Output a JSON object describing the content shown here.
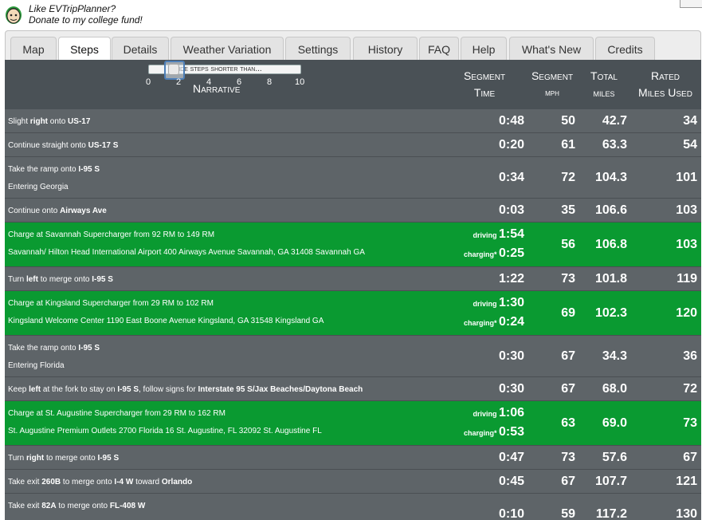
{
  "promo": {
    "line1": "Like EVTripPlanner?",
    "line2": "Donate to my college fund!"
  },
  "tabs": [
    {
      "label": "Map"
    },
    {
      "label": "Steps"
    },
    {
      "label": "Details"
    },
    {
      "label": "Weather Variation"
    },
    {
      "label": "Settings"
    },
    {
      "label": "History"
    },
    {
      "label": "FAQ"
    },
    {
      "label": "Help"
    },
    {
      "label": "What's New"
    },
    {
      "label": "Credits"
    }
  ],
  "active_tab": "Steps",
  "header": {
    "slider_label": "Hide steps shorter than...",
    "slider_ticks": [
      "0",
      "2",
      "4",
      "6",
      "8",
      "10"
    ],
    "slider_value": 1.5,
    "narrative": "Narrative",
    "segment_time": [
      "Segment",
      "Time"
    ],
    "segment_mph": [
      "Segment",
      "mph"
    ],
    "total_miles": [
      "Total",
      "miles"
    ],
    "rated_miles": [
      "Rated",
      "Miles Used"
    ]
  },
  "labels": {
    "driving": "driving",
    "charging": "charging*"
  },
  "rows": [
    {
      "type": "step",
      "l1": [
        [
          "Slight ",
          false
        ],
        [
          "right",
          true
        ],
        [
          " onto ",
          false
        ],
        [
          "US-17",
          true
        ]
      ],
      "time": "0:48",
      "mph": "50",
      "total": "42.7",
      "rated": "34"
    },
    {
      "type": "step",
      "l1": [
        [
          "Continue straight onto ",
          false
        ],
        [
          "US-17 S",
          true
        ]
      ],
      "time": "0:20",
      "mph": "61",
      "total": "63.3",
      "rated": "54"
    },
    {
      "type": "step2",
      "l1": [
        [
          "Take the ramp onto ",
          false
        ],
        [
          "I-95 S",
          true
        ]
      ],
      "l2": "Entering Georgia",
      "time": "0:34",
      "mph": "72",
      "total": "104.3",
      "rated": "101"
    },
    {
      "type": "step",
      "l1": [
        [
          "Continue onto ",
          false
        ],
        [
          "Airways Ave",
          true
        ]
      ],
      "time": "0:03",
      "mph": "35",
      "total": "106.6",
      "rated": "103"
    },
    {
      "type": "charge",
      "l1": "Charge at Savannah Supercharger from 92 RM to 149 RM",
      "l2": "Savannah/ Hilton Head International Airport 400 Airways Avenue Savannah, GA 31408 Savannah GA",
      "driving": "1:54",
      "charging": "0:25",
      "mph": "56",
      "total": "106.8",
      "rated": "103"
    },
    {
      "type": "step",
      "l1": [
        [
          "Turn ",
          false
        ],
        [
          "left",
          true
        ],
        [
          " to merge onto ",
          false
        ],
        [
          "I-95 S",
          true
        ]
      ],
      "time": "1:22",
      "mph": "73",
      "total": "101.8",
      "rated": "119"
    },
    {
      "type": "charge",
      "l1": "Charge at Kingsland Supercharger from 29 RM to 102 RM",
      "l2": "Kingsland Welcome Center 1190 East Boone Avenue Kingsland, GA 31548 Kingsland GA",
      "driving": "1:30",
      "charging": "0:24",
      "mph": "69",
      "total": "102.3",
      "rated": "120"
    },
    {
      "type": "step2",
      "l1": [
        [
          "Take the ramp onto ",
          false
        ],
        [
          "I-95 S",
          true
        ]
      ],
      "l2": "Entering Florida",
      "time": "0:30",
      "mph": "67",
      "total": "34.3",
      "rated": "36"
    },
    {
      "type": "step",
      "l1": [
        [
          "Keep ",
          false
        ],
        [
          "left",
          true
        ],
        [
          " at the fork to stay on ",
          false
        ],
        [
          "I-95 S",
          true
        ],
        [
          ", follow signs for ",
          false
        ],
        [
          "Interstate 95 S/Jax Beaches/Daytona Beach",
          true
        ]
      ],
      "time": "0:30",
      "mph": "67",
      "total": "68.0",
      "rated": "72"
    },
    {
      "type": "charge",
      "l1": "Charge at St. Augustine Supercharger from 29 RM to 162 RM",
      "l2": "St. Augustine Premium Outlets 2700 Florida 16 St. Augustine, FL 32092 St. Augustine FL",
      "driving": "1:06",
      "charging": "0:53",
      "mph": "63",
      "total": "69.0",
      "rated": "73"
    },
    {
      "type": "step",
      "l1": [
        [
          "Turn ",
          false
        ],
        [
          "right",
          true
        ],
        [
          " to merge onto ",
          false
        ],
        [
          "I-95 S",
          true
        ]
      ],
      "time": "0:47",
      "mph": "73",
      "total": "57.6",
      "rated": "67"
    },
    {
      "type": "step",
      "l1": [
        [
          "Take exit ",
          false
        ],
        [
          "260B",
          true
        ],
        [
          " to merge onto ",
          false
        ],
        [
          "I-4 W",
          true
        ],
        [
          " toward ",
          false
        ],
        [
          "Orlando",
          true
        ]
      ],
      "time": "0:45",
      "mph": "67",
      "total": "107.7",
      "rated": "121"
    },
    {
      "type": "step2",
      "l1": [
        [
          "Take exit ",
          false
        ],
        [
          "82A",
          true
        ],
        [
          " to merge onto ",
          false
        ],
        [
          "FL-408 W",
          true
        ]
      ],
      "l2": "",
      "time": "0:10",
      "mph": "59",
      "total": "117.2",
      "rated": "130"
    }
  ],
  "colors": {
    "header_bg": "#4a5156",
    "row_grey": "#5e6468",
    "row_green": "#0a9a31"
  }
}
